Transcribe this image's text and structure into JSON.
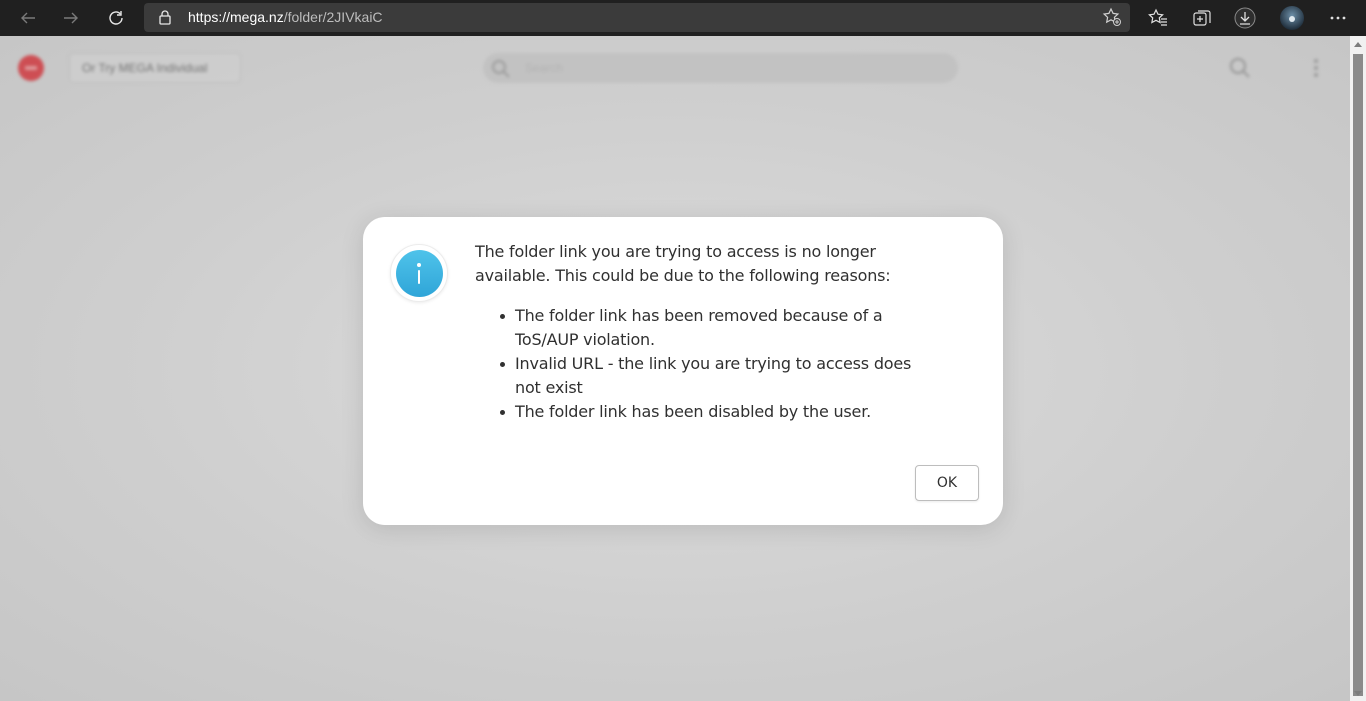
{
  "browser": {
    "url_host": "https://mega.nz",
    "url_path": "/folder/2JIVkaiC",
    "icons": [
      "back-icon",
      "forward-icon",
      "refresh-icon",
      "lock-icon",
      "add-favorite-icon",
      "favorites-icon",
      "collections-icon",
      "downloads-icon",
      "profile-avatar",
      "more-icon"
    ]
  },
  "page": {
    "header_button_label": "Or Try MEGA Individual",
    "search_placeholder": "Search"
  },
  "dialog": {
    "message": "The folder link you are trying to access is no longer available. This could be due to the following reasons:",
    "reasons": [
      "The folder link has been removed because of a ToS/AUP violation.",
      "Invalid URL - the link you are trying to access does not exist",
      "The folder link has been disabled by the user."
    ],
    "ok_label": "OK",
    "icon": "info-icon",
    "accent_color": "#3bb1e0"
  }
}
